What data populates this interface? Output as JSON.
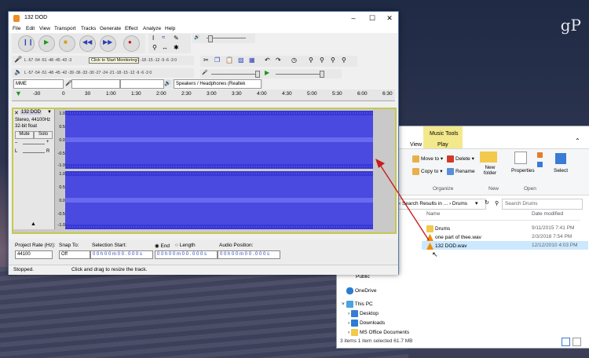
{
  "watermark": "gP",
  "explorer": {
    "ribbon_tabs": {
      "music_tools": "Music Tools",
      "view": "View",
      "play": "Play"
    },
    "ribbon_buttons": {
      "move_to": "Move to ▾",
      "delete": "Delete ▾",
      "copy_to": "Copy to ▾",
      "rename": "Rename",
      "new_folder": "New folder",
      "properties": "Properties",
      "select": "Select"
    },
    "groups": {
      "organize": "Organize",
      "new": "New",
      "open": "Open"
    },
    "address": "‹ Search Results in ... › Drums",
    "search_placeholder": "Search Drums",
    "columns": {
      "name": "Name",
      "date_modified": "Date modified"
    },
    "files": [
      {
        "name": "Drums",
        "date": "9/11/2015 7:41 PM",
        "icon": "folder-icon"
      },
      {
        "name": "one part of thee.wav",
        "date": "2/3/2018 7:54 PM",
        "icon": "vlc-icon"
      },
      {
        "name": "132 DOD.wav",
        "date": "12/12/2010 4:03 PM",
        "icon": "vlc-icon"
      }
    ],
    "nav": [
      "Public",
      "OneDrive",
      "This PC",
      "Desktop",
      "Downloads",
      "MS Office Documents"
    ],
    "status": "3 items     1 item selected  61.7 MB"
  },
  "audacity": {
    "title": "132 DOD",
    "window_buttons": {
      "minimize": "–",
      "maximize": "☐",
      "close": "✕"
    },
    "menu": [
      "File",
      "Edit",
      "View",
      "Transport",
      "Tracks",
      "Generate",
      "Effect",
      "Analyze",
      "Help"
    ],
    "meter_scale_rec": "L -57 -54 -51 -48 -45 -42 -3",
    "tooltip": "Click to Start Monitoring",
    "meter_scale_rec_tail": "-1 -18 -15 -12 -9 -6 -3 0",
    "meter_scale_play": "L -57 -54 -51 -48 -45 -42 -39 -36 -33 -30 -27 -24 -21 -18 -15 -12 -9 -6 -3 0",
    "device": {
      "host": "MME",
      "output": "Speakers / Headphones (Realtek"
    },
    "ruler": [
      "-30",
      "0",
      "30",
      "1:00",
      "1:30",
      "2:00",
      "2:30",
      "3:00",
      "3:30",
      "4:00",
      "4:30",
      "5:00",
      "5:30",
      "6:00",
      "6:30"
    ],
    "track": {
      "name": "132 DOD",
      "info": "Stereo, 44100Hz",
      "format": "32-bit float",
      "mute": "Mute",
      "solo": "Solo",
      "axis": [
        "1.0",
        "0.5",
        "0.0",
        "-0.5",
        "-1.0"
      ]
    },
    "bottom": {
      "project_rate_label": "Project Rate (Hz):",
      "project_rate": "44100",
      "snap_label": "Snap To:",
      "snap": "Off",
      "selection_start_label": "Selection Start:",
      "selection_start": "0 0 h 0 0 m 0 0 . 0 0 0 s",
      "end_label": "End",
      "length_label": "Length",
      "end_value": "0 0 h 0 0 m 0 0 . 0 0 0 s",
      "audio_position_label": "Audio Position:",
      "audio_position": "0 0 h 0 0 m 0 0 . 0 0 0 s"
    },
    "status_left": "Stopped.",
    "status_right": "Click and drag to resize the track."
  }
}
